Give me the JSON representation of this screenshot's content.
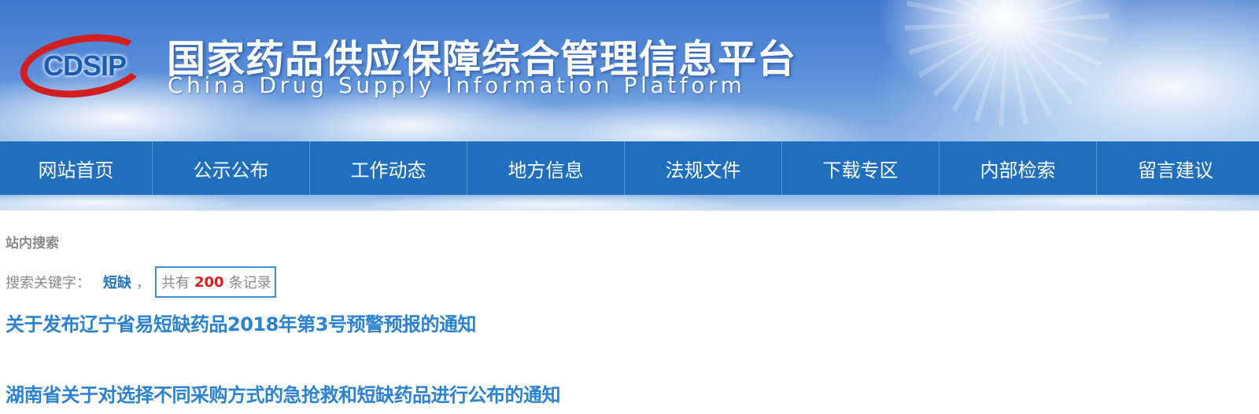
{
  "header": {
    "logo_text": "CDSIP",
    "title": "国家药品供应保障综合管理信息平台",
    "subtitle": "China Drug Supply  Information Platform"
  },
  "nav": {
    "items": [
      {
        "label": "网站首页"
      },
      {
        "label": "公示公布"
      },
      {
        "label": "工作动态"
      },
      {
        "label": "地方信息"
      },
      {
        "label": "法规文件"
      },
      {
        "label": "下载专区"
      },
      {
        "label": "内部检索"
      },
      {
        "label": "留言建议"
      }
    ]
  },
  "search": {
    "section_title": "站内搜索",
    "keyword_label": "搜索关键字：",
    "keyword": "短缺",
    "comma": "，",
    "count_prefix": "共有",
    "count": "200",
    "count_suffix": "条记录"
  },
  "results": [
    {
      "title": "关于发布辽宁省易短缺药品2018年第3号预警预报的通知"
    },
    {
      "title": "湖南省关于对选择不同采购方式的急抢救和短缺药品进行公布的通知"
    }
  ],
  "colors": {
    "nav_bg": "#1f6fbe",
    "link": "#2a82d6",
    "count_highlight": "#e01b1b",
    "logo_ring": "#d11f1f",
    "logo_text": "#1c5db4"
  }
}
